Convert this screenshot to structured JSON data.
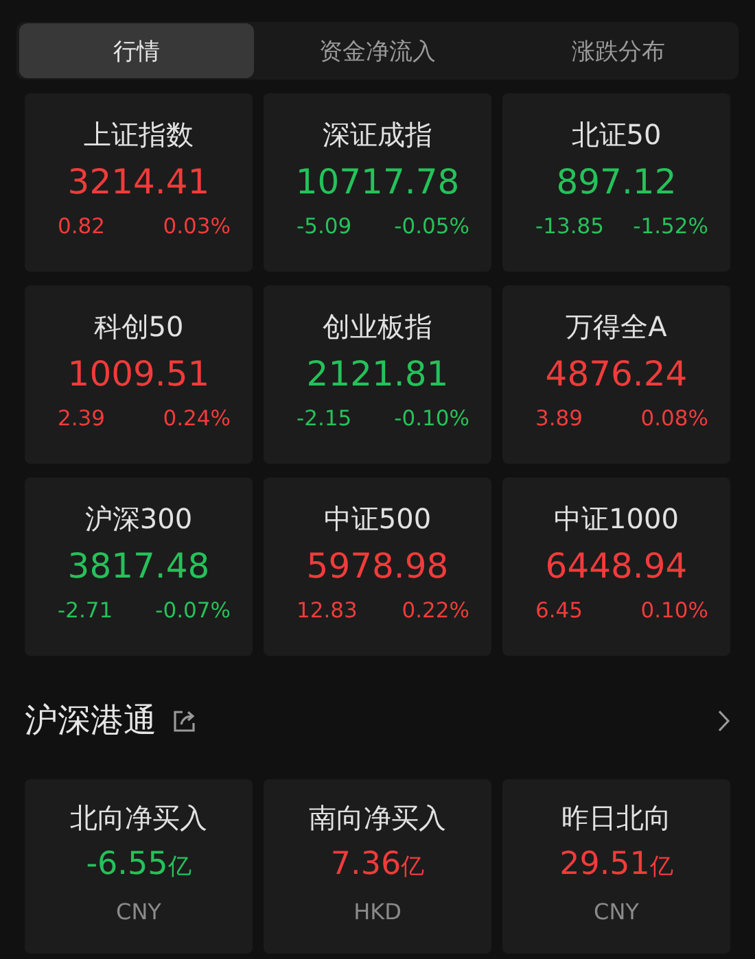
{
  "tabs": [
    {
      "label": "行情",
      "selected": true
    },
    {
      "label": "资金净流入",
      "selected": false
    },
    {
      "label": "涨跌分布",
      "selected": false
    }
  ],
  "indices": [
    {
      "name": "上证指数",
      "value": "3214.41",
      "change": "0.82",
      "percent": "0.03%",
      "color": "#f23b3b"
    },
    {
      "name": "深证成指",
      "value": "10717.78",
      "change": "-5.09",
      "percent": "-0.05%",
      "color": "#25c25a"
    },
    {
      "name": "北证50",
      "value": "897.12",
      "change": "-13.85",
      "percent": "-1.52%",
      "color": "#25c25a"
    },
    {
      "name": "科创50",
      "value": "1009.51",
      "change": "2.39",
      "percent": "0.24%",
      "color": "#f23b3b"
    },
    {
      "name": "创业板指",
      "value": "2121.81",
      "change": "-2.15",
      "percent": "-0.10%",
      "color": "#25c25a"
    },
    {
      "name": "万得全A",
      "value": "4876.24",
      "change": "3.89",
      "percent": "0.08%",
      "color": "#f23b3b"
    },
    {
      "name": "沪深300",
      "value": "3817.48",
      "change": "-2.71",
      "percent": "-0.07%",
      "color": "#25c25a"
    },
    {
      "name": "中证500",
      "value": "5978.98",
      "change": "12.83",
      "percent": "0.22%",
      "color": "#f23b3b"
    },
    {
      "name": "中证1000",
      "value": "6448.94",
      "change": "6.45",
      "percent": "0.10%",
      "color": "#f23b3b"
    }
  ],
  "section": {
    "title": "沪深港通"
  },
  "flows": [
    {
      "name": "北向净买入",
      "value": "-6.55",
      "unit": "亿",
      "currency": "CNY",
      "color": "#25c25a"
    },
    {
      "name": "南向净买入",
      "value": "7.36",
      "unit": "亿",
      "currency": "HKD",
      "color": "#f23b3b"
    },
    {
      "name": "昨日北向",
      "value": "29.51",
      "unit": "亿",
      "currency": "CNY",
      "color": "#f23b3b"
    }
  ]
}
